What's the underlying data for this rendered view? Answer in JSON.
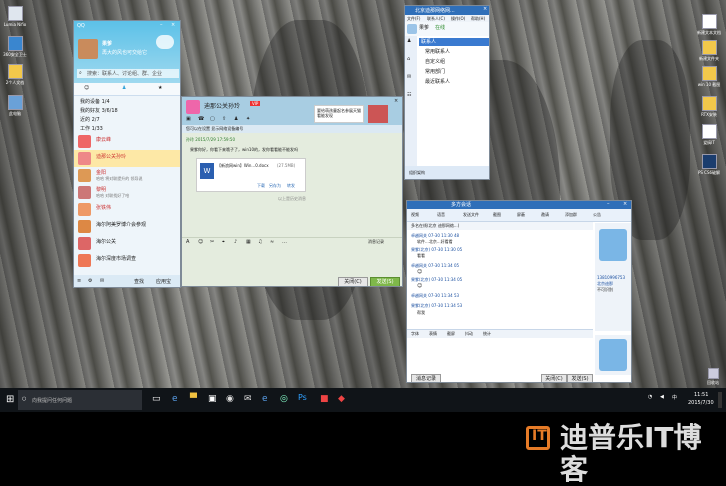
{
  "desktop": {
    "icons_left": [
      {
        "label": "Lumia Nifio",
        "icon": "computer-icon"
      },
      {
        "label": "360安全卫士",
        "icon": "security-icon"
      },
      {
        "label": "2个人文档",
        "icon": "folder-icon"
      },
      {
        "label": "此电脑",
        "icon": "computer-icon"
      }
    ],
    "icons_right": [
      {
        "label": "新建文本文档",
        "icon": "text-file-icon"
      },
      {
        "label": "新建文件夹",
        "icon": "folder-icon"
      },
      {
        "label": "win 10 截图",
        "icon": "folder-icon"
      },
      {
        "label": "RTX安装",
        "icon": "folder-icon"
      },
      {
        "label": "爱搞IT",
        "icon": "file-icon"
      },
      {
        "label": "PS CS6破解",
        "icon": "file-icon"
      }
    ],
    "recycle_label": "回收站"
  },
  "qq_main": {
    "title": "QQ",
    "user_name": "果爹",
    "signature": "再大的风也可交给它",
    "search_placeholder": "搜索：联系人、讨论组、群、企业",
    "groups": [
      {
        "label": "我的设备 1/4"
      },
      {
        "label": "我的好友 3/6/18"
      },
      {
        "label": "近的 2/7"
      },
      {
        "label": "工作 1/33"
      }
    ],
    "contacts": [
      {
        "name": "康云峰",
        "status": ""
      },
      {
        "name": "迪那公关孙玲",
        "status": ""
      },
      {
        "name": "金阳",
        "status": "哈哈 将对联提升的 领导说"
      },
      {
        "name": "黎明",
        "status": "哈哈 对联找好了哈"
      },
      {
        "name": "张铁伟",
        "status": ""
      },
      {
        "name": "海尔阿美罗博介会参观",
        "status": ""
      },
      {
        "name": "海尔公关",
        "status": ""
      },
      {
        "name": "海尔深度市场调查",
        "status": ""
      }
    ],
    "footer_items": [
      {
        "label": "查找"
      },
      {
        "label": "应用宝"
      }
    ]
  },
  "chat": {
    "title": "迪那公关孙玲",
    "badge": "VIP",
    "notice": "您可以在设置 显示网络设备编号",
    "timestamp": "孙玲 2015/7/29 17:59:50",
    "message": "果爹你好，你看下来哦子了，win10的，发你看看能不能发吗",
    "file_name": "【新浪网win】Win...0.docx",
    "file_size": "(27.5MB)",
    "file_actions": [
      "下载",
      "另存为",
      "转发"
    ],
    "divider": "以上是历史消息",
    "input_icons": [
      "font-icon",
      "emoji-icon",
      "screenshot-icon",
      "scissors-icon",
      "mic-icon",
      "image-icon",
      "music-icon",
      "shake-icon",
      "more-icon"
    ],
    "history_label": "消息记录",
    "close_label": "关闭(C)",
    "send_label": "发送(S)",
    "ad_text": "要给萌孩童起名参展天猫看能发现"
  },
  "rtx": {
    "title": "北京迪那网络网...",
    "menu": [
      "文件(F)",
      "联系人(C)",
      "操作(O)",
      "帮助(H)"
    ],
    "user": "果爹",
    "status": "在线",
    "tree_header": "联系人",
    "tree": [
      "常用联系人",
      "自定义组",
      "常用部门",
      "最近联系人"
    ],
    "footer": "组织架构"
  },
  "rtx_chat": {
    "title": "多方会话",
    "tab_title": "多方 ",
    "toolbar": [
      "视频",
      "语音",
      "发送文件",
      "截图",
      "屏蔽",
      "邀请",
      "添加群",
      "公告"
    ],
    "subtitle": "多名在线(北京 迪那网络...)",
    "messages": [
      {
        "head": "卓越网关 07-30 11:30 48",
        "text": "软件...北京...好看看"
      },
      {
        "head": "果爹(北京) 07-30 11:30 05",
        "text": "看看"
      },
      {
        "head": "卓越网关 07-30 11:34 05",
        "text": ""
      },
      {
        "head": "果爹(北京) 07-30 11:34 05",
        "text": ""
      },
      {
        "head": "卓越网关 07-30 11:34 53",
        "text": ""
      },
      {
        "head": "果爹(北京) 07-30 11:34 53",
        "text": "帮我"
      }
    ],
    "toolbar2": [
      "字体",
      "表情",
      "截屏",
      "抖动",
      "统计"
    ],
    "history_label": "消息记录",
    "close_label": "关闭(C)",
    "send_label": "发送(S)",
    "right_lines": [
      "13810996753",
      "北京迪那",
      "不可识别"
    ]
  },
  "taskbar": {
    "search_placeholder": "向我提问任何问题",
    "time": "11:51",
    "date": "2015/7/30"
  },
  "watermark": {
    "text": "迪普乐IT博客"
  },
  "colors": {
    "qq_blue": "#2fa0d8",
    "chat_header": "#9fc9e0",
    "rtx_blue": "#2f6fb9",
    "send_green": "#7fb84a",
    "watermark_orange": "#e67b27"
  }
}
